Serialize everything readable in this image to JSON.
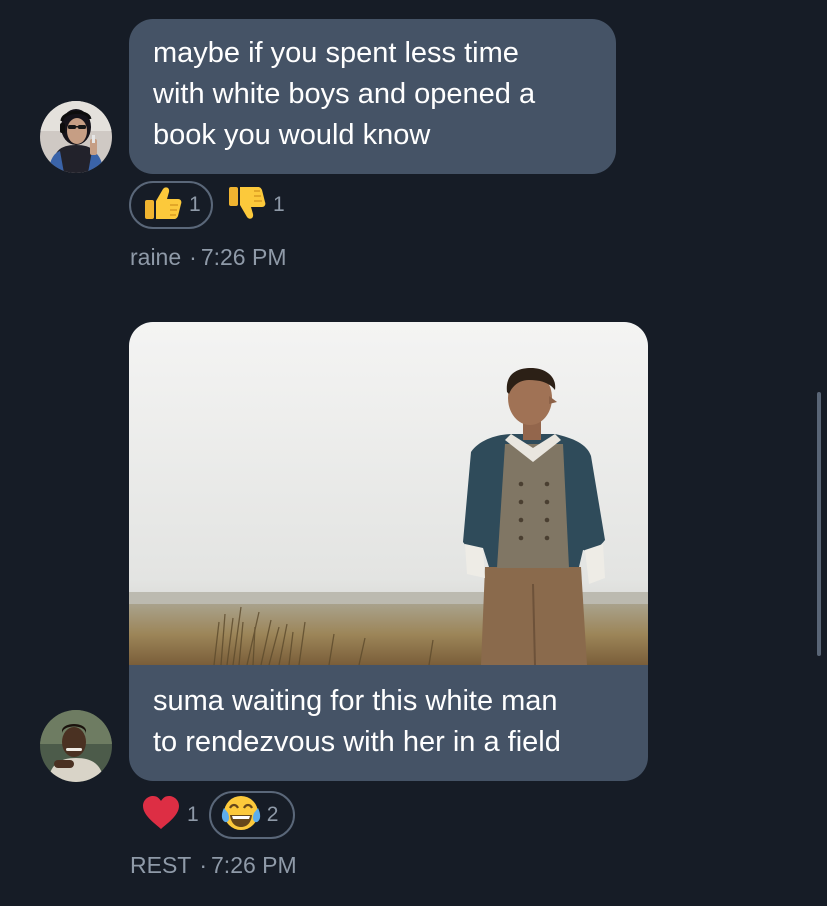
{
  "messages": [
    {
      "author": "raine",
      "time": "7:26 PM",
      "lines": [
        "maybe if you spent less time",
        "with white boys and opened a",
        "book you would know"
      ],
      "reactions": [
        {
          "emoji": "thumbs-up-icon",
          "count": "1",
          "selected": true
        },
        {
          "emoji": "thumbs-down-icon",
          "count": "1",
          "selected": false
        }
      ]
    },
    {
      "author": "REST",
      "time": "7:26 PM",
      "lines": [
        "suma waiting for this white man",
        "to rendezvous with her in a field"
      ],
      "reactions": [
        {
          "emoji": "heart-icon",
          "count": "1",
          "selected": false
        },
        {
          "emoji": "tears-of-joy-icon",
          "count": "2",
          "selected": true
        }
      ]
    }
  ],
  "separator": "·",
  "colors": {
    "background": "#161c26",
    "bubble": "#455366",
    "meta_text": "#8f9aa8",
    "reaction_border": "#5a6779"
  }
}
